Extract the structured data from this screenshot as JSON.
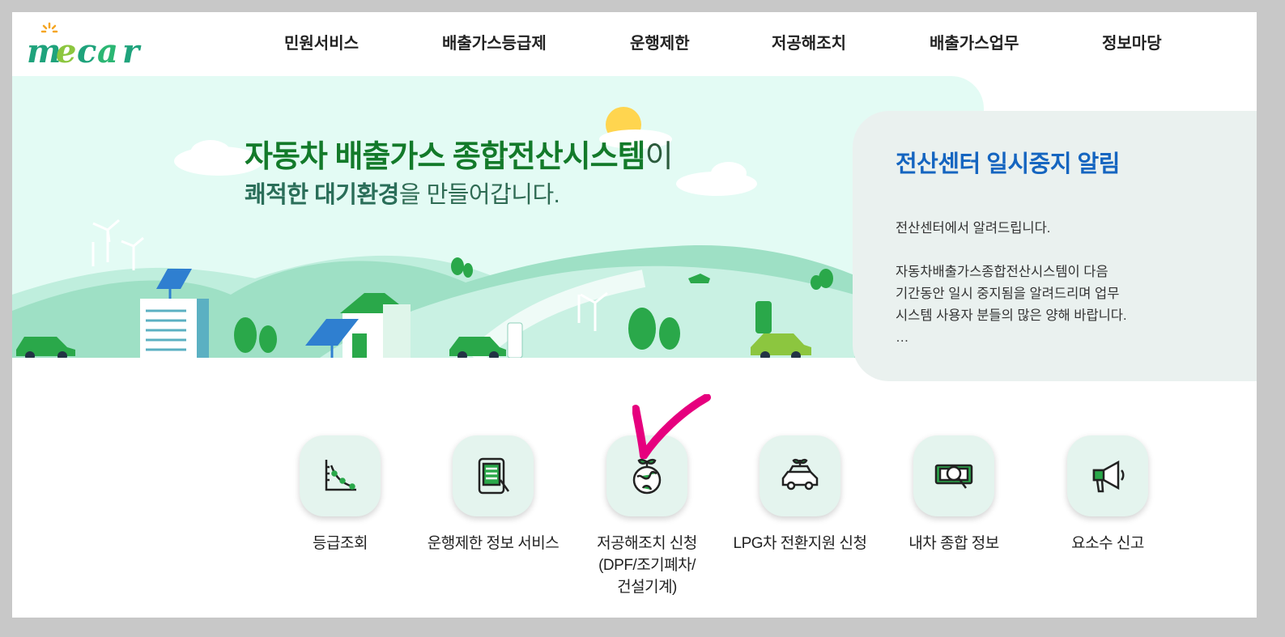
{
  "brand": {
    "logo_text": "mecar"
  },
  "nav": [
    {
      "label": "민원서비스"
    },
    {
      "label": "배출가스등급제"
    },
    {
      "label": "운행제한"
    },
    {
      "label": "저공해조치"
    },
    {
      "label": "배출가스업무"
    },
    {
      "label": "정보마당"
    }
  ],
  "hero": {
    "headline_main": "자동차 배출가스 종합전산시스템",
    "headline_suffix": "이",
    "subline_bold": "쾌적한 대기환경",
    "subline_rest": "을 만들어갑니다."
  },
  "notice": {
    "title": "전산센터 일시중지 알림",
    "line1": "전산센터에서 알려드립니다.",
    "line2": "자동차배출가스종합전산시스템이 다음",
    "line3": "기간동안 일시 중지됨을 알려드리며 업무",
    "line4": "시스템 사용자 분들의 많은 양해 바랍니다.",
    "line5": "…"
  },
  "services": [
    {
      "icon": "grade-chart-icon",
      "label": "등급조회"
    },
    {
      "icon": "tablet-info-icon",
      "label": "운행제한 정보 서비스"
    },
    {
      "icon": "earth-sprout-icon",
      "label_line1": "저공해조치 신청",
      "label_line2": "(DPF/조기폐차/",
      "label_line3": "건설기계)"
    },
    {
      "icon": "eco-car-icon",
      "label": "LPG차 전환지원 신청"
    },
    {
      "icon": "car-search-icon",
      "label": "내차 종합 정보"
    },
    {
      "icon": "megaphone-icon",
      "label": "요소수 신고"
    }
  ],
  "colors": {
    "brand_green": "#137a2a",
    "notice_blue": "#1565c0",
    "hero_bg": "#e3fbf4",
    "check_mark": "#e6007e"
  }
}
